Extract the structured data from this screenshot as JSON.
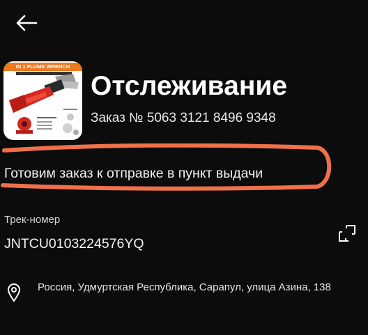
{
  "header": {
    "back_icon": "arrow-left-icon"
  },
  "product": {
    "banner_text": "IN 1 FLUME WRENCH",
    "image_icon": "red-wrench-tool-image"
  },
  "tracking": {
    "title": "Отслеживание",
    "order_number": "Заказ № 5063 3121 8496 9348",
    "status": "Готовим заказ к отправке в пункт выдачи",
    "highlight_color": "#f0704a",
    "track_label": "Трек-номер",
    "track_number": "JNTCU0103224576YQ",
    "copy_icon": "copy-icon",
    "address_icon": "location-pin-icon",
    "address": "Россия, Удмуртская Республика, Сарапул, улица Азина, 138"
  },
  "colors": {
    "background": "#0c0c0c",
    "text": "#ffffff",
    "accent": "#f0704a"
  }
}
